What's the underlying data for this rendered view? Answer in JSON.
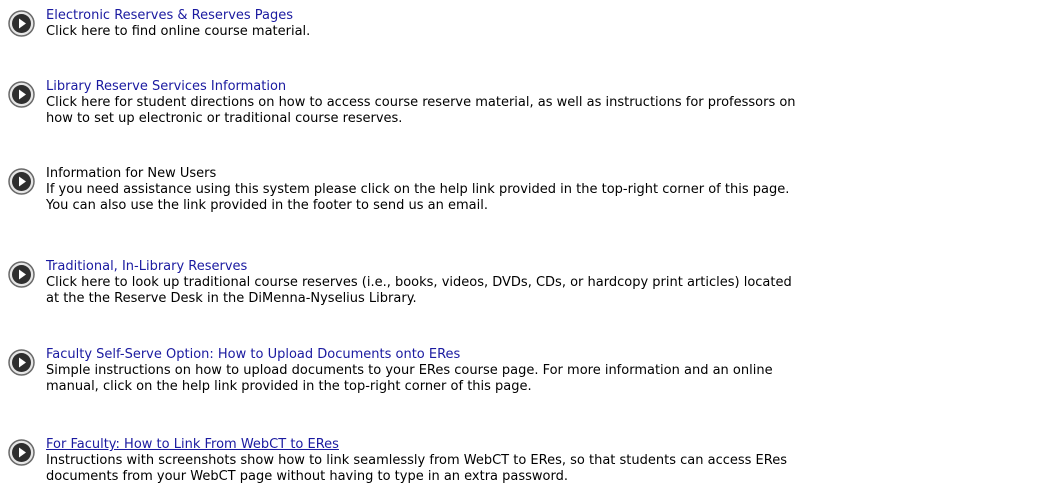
{
  "items": [
    {
      "title": "Electronic Reserves & Reserves Pages",
      "description": [
        "Click here to find online course material."
      ]
    },
    {
      "title": "Library Reserve Services Information",
      "description": [
        "Click here for student directions on how to access course reserve material, as well as instructions for professors on",
        "how to set up electronic or traditional course reserves."
      ]
    },
    {
      "title": "Information for New Users",
      "description": [
        "If you need assistance using this system please click on the help link provided in the top-right corner of this page.",
        "You can also use the link provided in the footer to send us an email."
      ]
    },
    {
      "title": "Traditional, In-Library Reserves",
      "description": [
        "Click here to look up traditional course reserves (i.e., books, videos, DVDs, CDs, or hardcopy print articles) located",
        "at the the Reserve Desk in the DiMenna-Nyselius Library."
      ]
    },
    {
      "title": "Faculty Self-Serve Option: How to Upload Documents onto ERes",
      "description": [
        "Simple instructions on how to upload documents to your ERes course page. For more information and an online",
        "manual, click on the help link provided in the top-right corner of this page."
      ]
    },
    {
      "title": "For Faculty: How to Link From WebCT to ERes",
      "description": [
        "Instructions with screenshots show how to link seamlessly from WebCT to ERes, so that students can access ERes",
        "documents from your WebCT page without having to type in an extra password."
      ]
    }
  ],
  "icon": "arrow-circle-icon",
  "colors": {
    "link": "#1a1aa0",
    "text": "#000000",
    "icon_ring": "#6a6a6a",
    "icon_fill": "#2e2e2e"
  }
}
